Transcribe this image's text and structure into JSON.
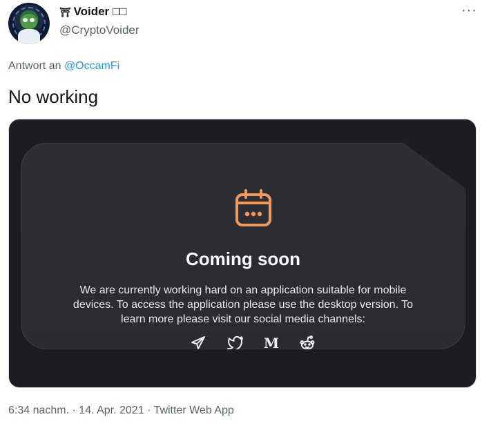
{
  "author": {
    "display_name": "Voider",
    "badge": "⛩",
    "name_suffix": "□□",
    "handle": "@CryptoVoider"
  },
  "more_label": "···",
  "reply": {
    "prefix": "Antwort an",
    "mention": "@OccamFi"
  },
  "tweet_text": "No working",
  "media": {
    "title": "Coming soon",
    "description": "We are currently working hard on an application suitable for mobile devices. To access the application please use the desktop version. To learn more please visit our social media channels:",
    "accent_color": "#f29a5c",
    "social_icons": [
      "telegram-icon",
      "twitter-icon",
      "medium-icon",
      "reddit-icon"
    ],
    "medium_letter": "M"
  },
  "meta": {
    "time": "6:34 nachm.",
    "sep1": "·",
    "date": "14. Apr. 2021",
    "sep2": "·",
    "source": "Twitter Web App"
  }
}
